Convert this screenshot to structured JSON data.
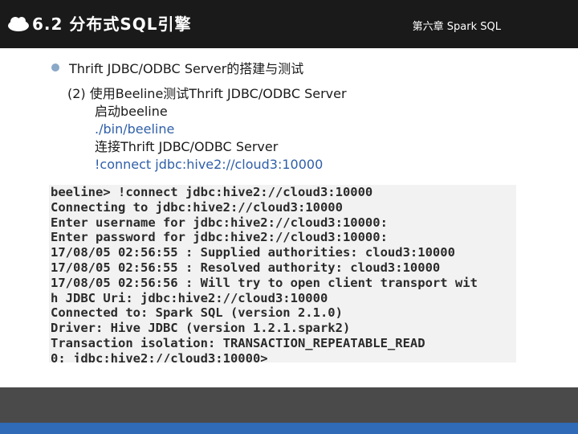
{
  "header": {
    "title": "6.2 分布式SQL引擎",
    "chapter": "第六章 Spark SQL",
    "logo_icon": "cloud-icon"
  },
  "content": {
    "bullet": "Thrift JDBC/ODBC Server的搭建与测试",
    "step": "(2) 使用Beeline测试Thrift JDBC/ODBC Server",
    "start_label": "启动beeline",
    "start_cmd": "./bin/beeline",
    "connect_label": "连接Thrift JDBC/ODBC Server",
    "connect_cmd": "!connect jdbc:hive2://cloud3:10000"
  },
  "terminal": {
    "lines": [
      "beeline> !connect jdbc:hive2://cloud3:10000",
      "Connecting to jdbc:hive2://cloud3:10000",
      "Enter username for jdbc:hive2://cloud3:10000:",
      "Enter password for jdbc:hive2://cloud3:10000:",
      "17/08/05 02:56:55 : Supplied authorities: cloud3:10000",
      "17/08/05 02:56:55 : Resolved authority: cloud3:10000",
      "17/08/05 02:56:56 : Will try to open client transport wit",
      "h JDBC Uri: jdbc:hive2://cloud3:10000",
      "Connected to: Spark SQL (version 2.1.0)",
      "Driver: Hive JDBC (version 1.2.1.spark2)",
      "Transaction isolation: TRANSACTION_REPEATABLE_READ",
      "0: jdbc:hive2://cloud3:10000>"
    ]
  },
  "colors": {
    "header_bg": "#1a1a1a",
    "accent_blue": "#2f5fa8",
    "footer_dark": "#4a4a4a",
    "footer_blue": "#2f6bb6"
  }
}
